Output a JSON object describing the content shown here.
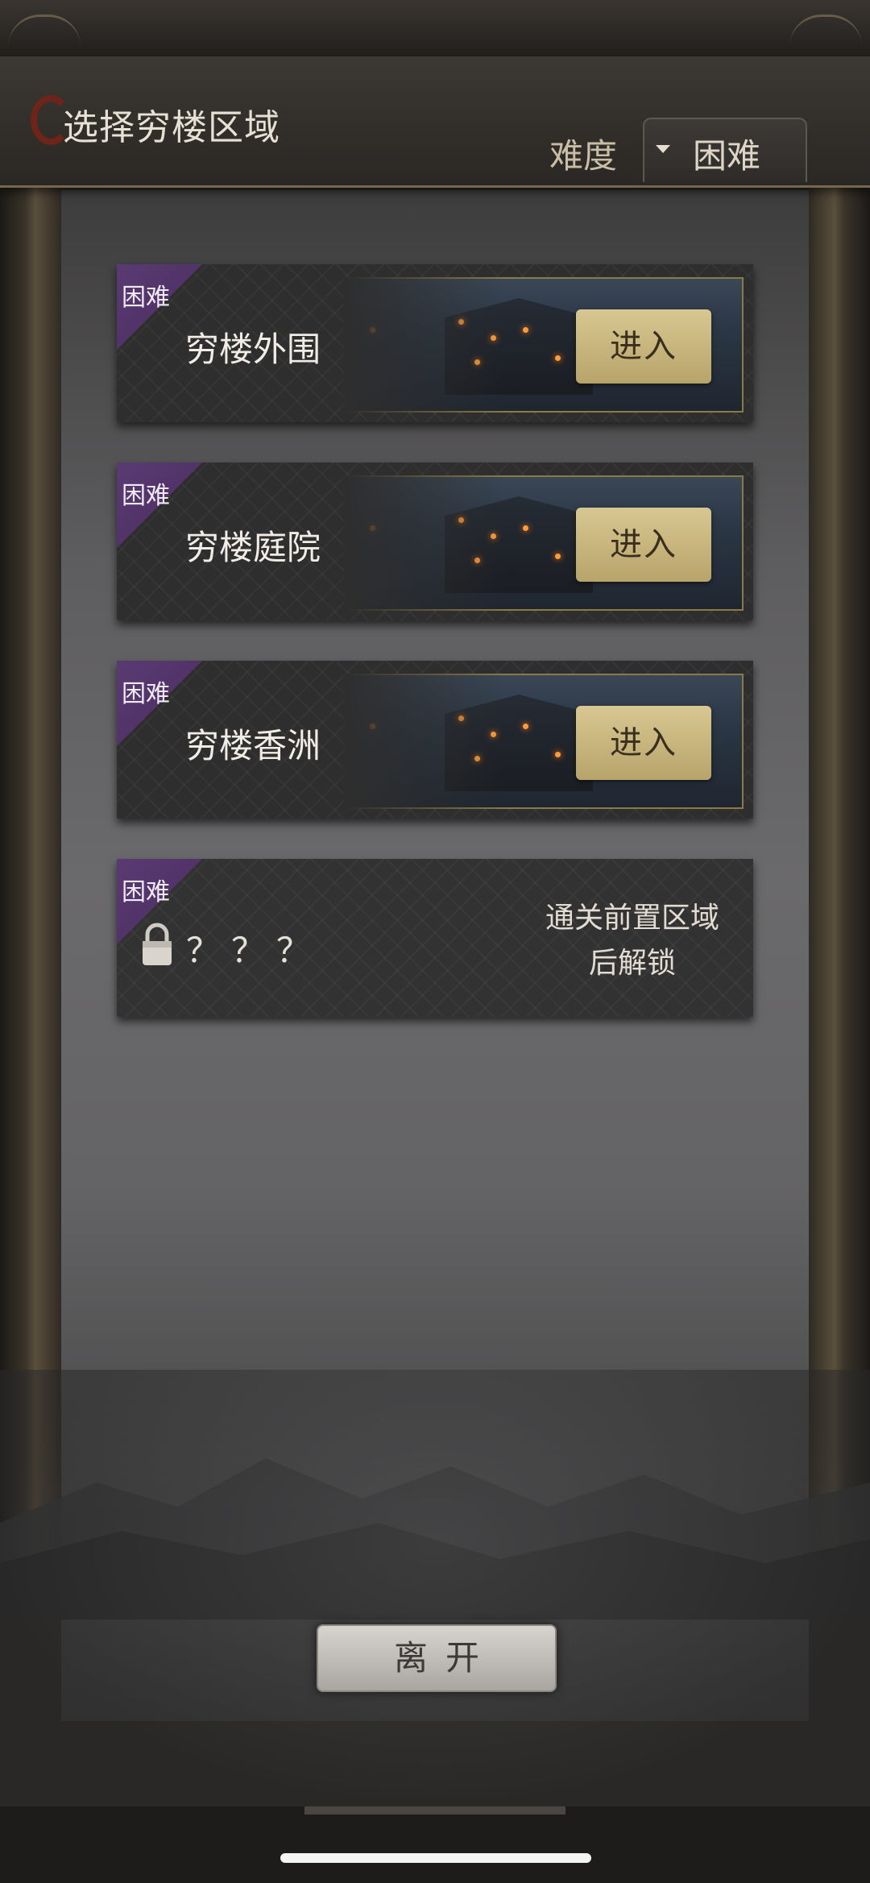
{
  "header": {
    "title": "选择穷楼区域",
    "difficulty_label": "难度",
    "difficulty_value": "困难"
  },
  "zones": [
    {
      "badge": "困难",
      "name": "穷楼外围",
      "button": "进入"
    },
    {
      "badge": "困难",
      "name": "穷楼庭院",
      "button": "进入"
    },
    {
      "badge": "困难",
      "name": "穷楼香洲",
      "button": "进入"
    }
  ],
  "locked_zone": {
    "badge": "困难",
    "name": "？？？",
    "note_line1": "通关前置区域",
    "note_line2": "后解锁"
  },
  "footer": {
    "leave_label": "离开"
  },
  "colors": {
    "badge_purple": "#5a3a72",
    "enter_gold": "#d8c792",
    "logo_red": "#6e2418"
  }
}
